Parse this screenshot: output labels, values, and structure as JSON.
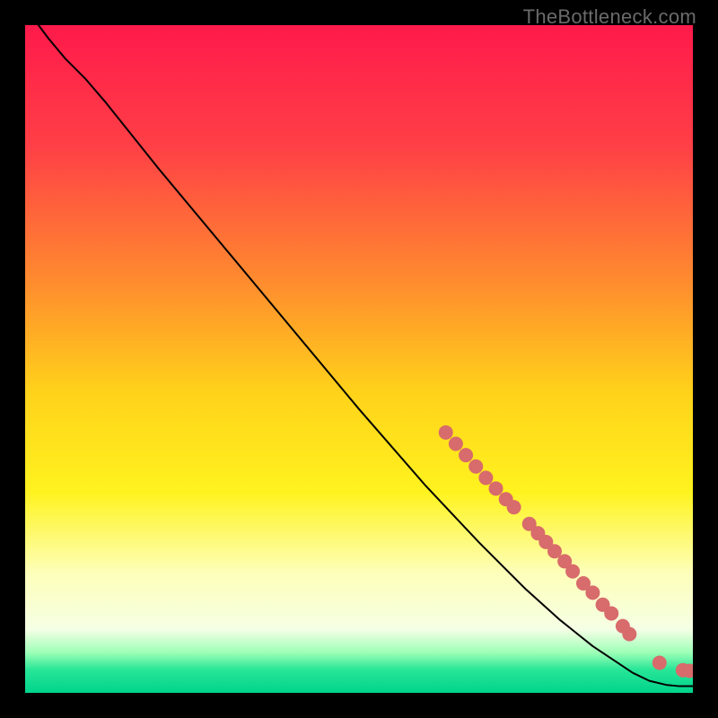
{
  "watermark": "TheBottleneck.com",
  "chart_data": {
    "type": "line",
    "title": "",
    "xlabel": "",
    "ylabel": "",
    "xlim": [
      0,
      100
    ],
    "ylim": [
      0,
      100
    ],
    "grid": false,
    "legend": false,
    "gradient_stops": [
      {
        "offset": 0.0,
        "color": "#ff1a4b"
      },
      {
        "offset": 0.18,
        "color": "#ff3f46"
      },
      {
        "offset": 0.38,
        "color": "#ff8a2f"
      },
      {
        "offset": 0.55,
        "color": "#ffd21a"
      },
      {
        "offset": 0.7,
        "color": "#fff31f"
      },
      {
        "offset": 0.82,
        "color": "#fdffb9"
      },
      {
        "offset": 0.905,
        "color": "#f5ffe5"
      },
      {
        "offset": 0.94,
        "color": "#9cffb6"
      },
      {
        "offset": 0.965,
        "color": "#28e697"
      },
      {
        "offset": 1.0,
        "color": "#00d38c"
      }
    ],
    "series": [
      {
        "name": "curve",
        "kind": "line",
        "color": "#000000",
        "points": [
          {
            "x": 2.0,
            "y": 100.0
          },
          {
            "x": 3.5,
            "y": 98.0
          },
          {
            "x": 6.0,
            "y": 95.0
          },
          {
            "x": 9.0,
            "y": 92.0
          },
          {
            "x": 12.0,
            "y": 88.5
          },
          {
            "x": 20.0,
            "y": 78.5
          },
          {
            "x": 30.0,
            "y": 66.5
          },
          {
            "x": 40.0,
            "y": 54.5
          },
          {
            "x": 50.0,
            "y": 42.5
          },
          {
            "x": 60.0,
            "y": 31.0
          },
          {
            "x": 68.0,
            "y": 22.5
          },
          {
            "x": 75.0,
            "y": 15.5
          },
          {
            "x": 80.0,
            "y": 11.0
          },
          {
            "x": 85.0,
            "y": 7.0
          },
          {
            "x": 88.0,
            "y": 5.0
          },
          {
            "x": 91.0,
            "y": 3.0
          },
          {
            "x": 93.5,
            "y": 1.8
          },
          {
            "x": 96.0,
            "y": 1.2
          },
          {
            "x": 98.0,
            "y": 1.0
          },
          {
            "x": 100.0,
            "y": 1.0
          }
        ]
      },
      {
        "name": "markers",
        "kind": "scatter",
        "color": "#d86b6b",
        "radius": 8,
        "points": [
          {
            "x": 63.0,
            "y": 39.0
          },
          {
            "x": 64.5,
            "y": 37.3
          },
          {
            "x": 66.0,
            "y": 35.6
          },
          {
            "x": 67.5,
            "y": 33.9
          },
          {
            "x": 69.0,
            "y": 32.2
          },
          {
            "x": 70.5,
            "y": 30.6
          },
          {
            "x": 72.0,
            "y": 29.0
          },
          {
            "x": 73.2,
            "y": 27.8
          },
          {
            "x": 75.5,
            "y": 25.3
          },
          {
            "x": 76.8,
            "y": 23.9
          },
          {
            "x": 78.0,
            "y": 22.6
          },
          {
            "x": 79.3,
            "y": 21.2
          },
          {
            "x": 80.8,
            "y": 19.7
          },
          {
            "x": 82.0,
            "y": 18.2
          },
          {
            "x": 83.6,
            "y": 16.4
          },
          {
            "x": 85.0,
            "y": 15.0
          },
          {
            "x": 86.5,
            "y": 13.2
          },
          {
            "x": 87.8,
            "y": 11.9
          },
          {
            "x": 89.5,
            "y": 10.0
          },
          {
            "x": 90.5,
            "y": 8.8
          },
          {
            "x": 95.0,
            "y": 4.5
          },
          {
            "x": 98.5,
            "y": 3.4
          },
          {
            "x": 99.5,
            "y": 3.3
          }
        ]
      }
    ]
  }
}
